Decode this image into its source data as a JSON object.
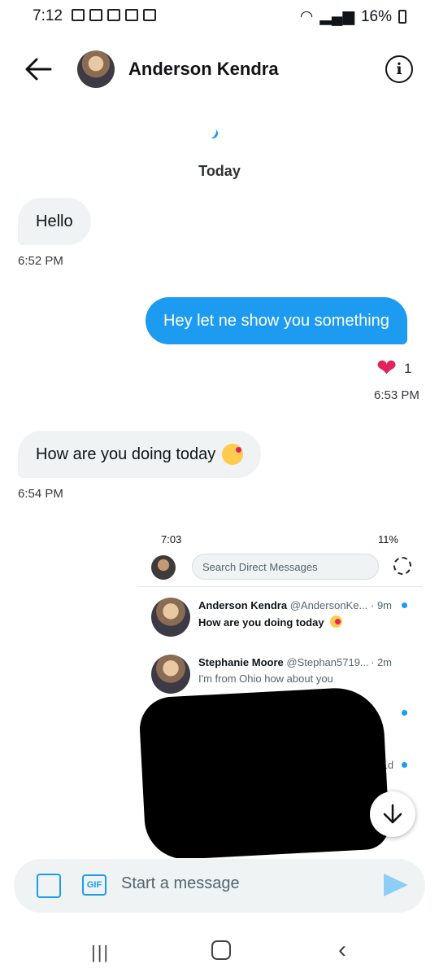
{
  "status_bar": {
    "time": "7:12",
    "battery": "16%"
  },
  "header": {
    "name": "Anderson Kendra",
    "info_icon": "info-icon",
    "back_icon": "arrow-left-icon"
  },
  "date_separator": "Today",
  "messages": [
    {
      "text": "Hello",
      "time": "6:52 PM"
    },
    {
      "text": "Hey let ne show you something",
      "time": "6:53 PM",
      "reaction_count": "1"
    },
    {
      "text": "How are you doing today",
      "time": "6:54 PM"
    }
  ],
  "shared_screenshot": {
    "status_time": "7:03",
    "status_battery": "11%",
    "search_placeholder": "Search Direct Messages",
    "rows": [
      {
        "name": "Anderson Kendra",
        "handle": "@AndersonKe...",
        "time": "· 9m",
        "preview": "How are you doing today"
      },
      {
        "name": "Stephanie Moore",
        "handle": "@Stephan5719...",
        "time": "· 2m",
        "preview": "I'm from Ohio how about you"
      }
    ],
    "partial_time": "1... · 1d"
  },
  "composer": {
    "gif_label": "GIF",
    "placeholder": "Start a message"
  },
  "colors": {
    "accent": "#1d9bf0",
    "incoming_bubble": "#eff3f4",
    "heart": "#e0245e"
  }
}
